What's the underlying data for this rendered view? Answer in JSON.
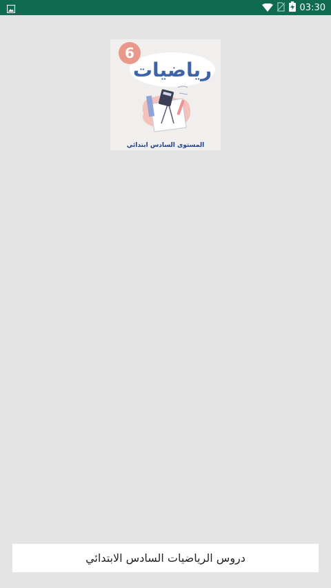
{
  "status_bar": {
    "time": "03:30",
    "icons": [
      "image-notification-icon",
      "wifi-icon",
      "no-sim-icon",
      "battery-charging-icon"
    ],
    "background": "#0e6b4f"
  },
  "cover": {
    "number": "6",
    "title": "رياضيات",
    "subtitle": "المستوى السادس ابتدائي",
    "accent": "#e8998b",
    "title_color": "#3f63a8"
  },
  "bottom_label": "دروس الرياضيات السادس الابتدائي"
}
